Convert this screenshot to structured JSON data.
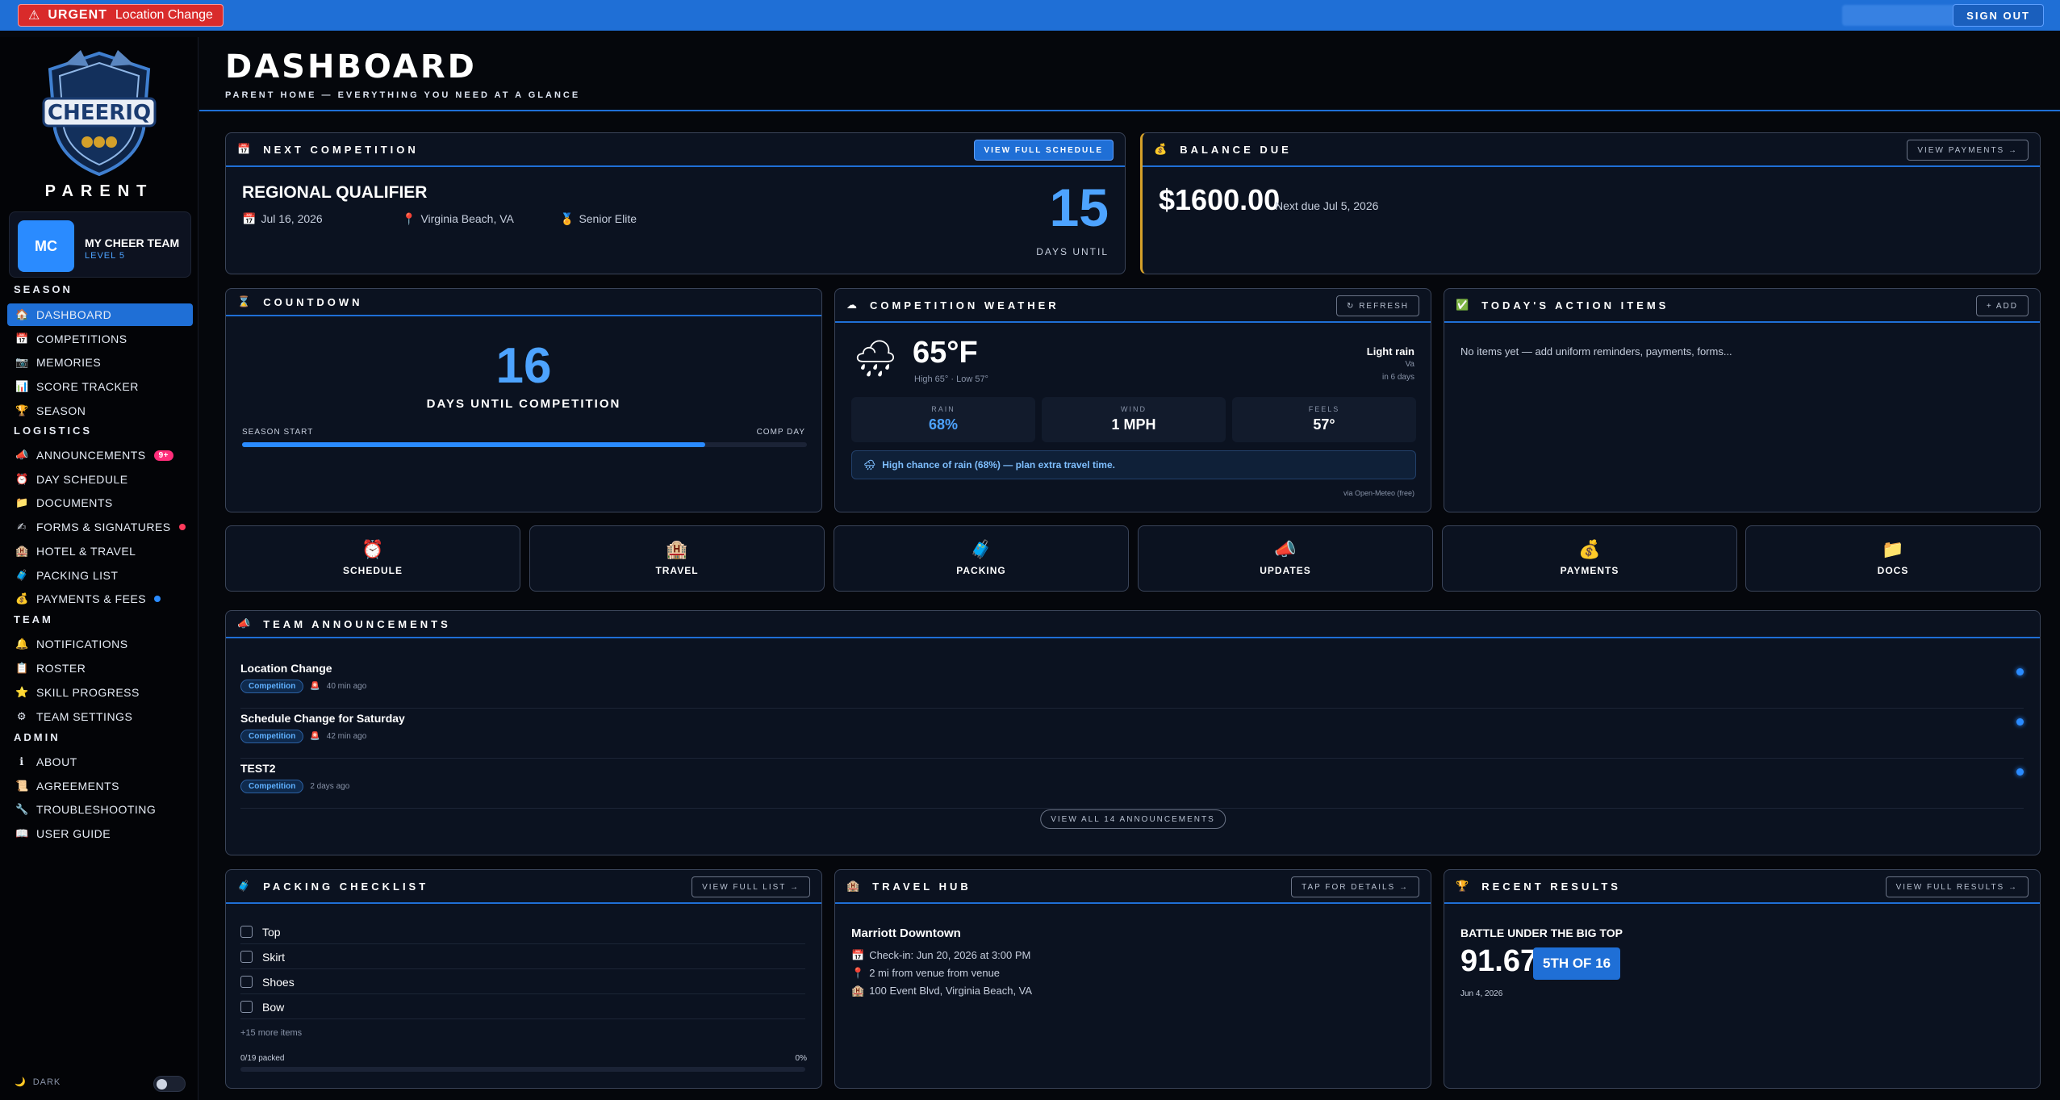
{
  "topbar": {
    "urgent_tag": "URGENT",
    "urgent_text": "Location Change",
    "signout": "SIGN OUT"
  },
  "sidebar": {
    "logo_text": "CHEERIQ",
    "role": "PARENT",
    "team": {
      "initials": "MC",
      "name": "MY CHEER TEAM",
      "level": "LEVEL 5"
    },
    "sections": {
      "season": "SEASON",
      "logistics": "LOGISTICS",
      "team": "TEAM",
      "admin": "ADMIN"
    },
    "season_items": [
      {
        "label": "DASHBOARD",
        "icon": "house-icon"
      },
      {
        "label": "COMPETITIONS",
        "icon": "calendar-icon"
      },
      {
        "label": "MEMORIES",
        "icon": "camera-icon"
      },
      {
        "label": "SCORE TRACKER",
        "icon": "chart-icon"
      },
      {
        "label": "SEASON",
        "icon": "trophy-icon"
      }
    ],
    "logistics_items": [
      {
        "label": "ANNOUNCEMENTS",
        "icon": "megaphone-icon",
        "badge": "9+"
      },
      {
        "label": "DAY SCHEDULE",
        "icon": "alarm-clock-icon"
      },
      {
        "label": "DOCUMENTS",
        "icon": "folder-icon"
      },
      {
        "label": "FORMS & SIGNATURES",
        "icon": "writing-hand-icon"
      },
      {
        "label": "HOTEL & TRAVEL",
        "icon": "hotel-icon"
      },
      {
        "label": "PACKING LIST",
        "icon": "luggage-icon"
      },
      {
        "label": "PAYMENTS & FEES",
        "icon": "money-bag-icon"
      }
    ],
    "team_items": [
      {
        "label": "NOTIFICATIONS",
        "icon": "bell-icon"
      },
      {
        "label": "ROSTER",
        "icon": "clipboard-icon"
      },
      {
        "label": "SKILL PROGRESS",
        "icon": "star-icon"
      },
      {
        "label": "TEAM SETTINGS",
        "icon": "gear-icon"
      }
    ],
    "admin_items": [
      {
        "label": "ABOUT",
        "icon": "info-icon"
      },
      {
        "label": "AGREEMENTS",
        "icon": "scroll-icon"
      },
      {
        "label": "TROUBLESHOOTING",
        "icon": "wrench-icon"
      },
      {
        "label": "USER GUIDE",
        "icon": "book-icon"
      }
    ],
    "dark_label": "DARK"
  },
  "header": {
    "title": "DASHBOARD",
    "subtitle": "PARENT HOME — EVERYTHING YOU NEED AT A GLANCE"
  },
  "next_comp": {
    "heading": "NEXT COMPETITION",
    "button": "VIEW FULL SCHEDULE",
    "name": "REGIONAL QUALIFIER",
    "date": "Jul 16, 2026",
    "location": "Virginia Beach, VA",
    "division": "Senior Elite",
    "days": "15",
    "days_label": "DAYS UNTIL"
  },
  "balance": {
    "heading": "BALANCE DUE",
    "button": "VIEW PAYMENTS →",
    "amount": "$1600.00",
    "due": "Next due Jul 5, 2026"
  },
  "countdown": {
    "heading": "COUNTDOWN",
    "days": "16",
    "label": "DAYS UNTIL COMPETITION",
    "start": "SEASON START",
    "end": "COMP DAY",
    "progress": 0.82
  },
  "weather": {
    "heading": "COMPETITION WEATHER",
    "button": "↻ REFRESH",
    "temp": "65°F",
    "hilo": "High 65° · Low 57°",
    "condition": "Light rain",
    "region": "Va",
    "when": "in 6 days",
    "rain_label": "RAIN",
    "rain": "68%",
    "wind_label": "WIND",
    "wind": "1 MPH",
    "feels_label": "FEELS",
    "feels": "57°",
    "alert": "High chance of rain (68%) — plan extra travel time.",
    "source": "via Open-Meteo (free)"
  },
  "actions": {
    "heading": "TODAY'S ACTION ITEMS",
    "button": "+ ADD",
    "empty": "No items yet — add uniform reminders, payments, forms..."
  },
  "tiles": [
    {
      "label": "SCHEDULE",
      "icon": "alarm-clock-icon",
      "glyph": "⏰"
    },
    {
      "label": "TRAVEL",
      "icon": "hotel-icon",
      "glyph": "🏨"
    },
    {
      "label": "PACKING",
      "icon": "luggage-icon",
      "glyph": "🧳"
    },
    {
      "label": "UPDATES",
      "icon": "megaphone-icon",
      "glyph": "📣"
    },
    {
      "label": "PAYMENTS",
      "icon": "money-bag-icon",
      "glyph": "💰"
    },
    {
      "label": "DOCS",
      "icon": "folder-icon",
      "glyph": "📁"
    }
  ],
  "announcements": {
    "heading": "TEAM ANNOUNCEMENTS",
    "view_all": "VIEW ALL 14 ANNOUNCEMENTS",
    "items": [
      {
        "title": "Location Change",
        "tag": "Competition",
        "time": "40 min ago"
      },
      {
        "title": "Schedule Change for Saturday",
        "tag": "Competition",
        "time": "42 min ago"
      },
      {
        "title": "TEST2",
        "tag": "Competition",
        "time": "2 days ago"
      }
    ]
  },
  "packing": {
    "heading": "PACKING CHECKLIST",
    "button": "VIEW FULL LIST →",
    "items": [
      "Top",
      "Skirt",
      "Shoes",
      "Bow"
    ],
    "more": "+15 more items",
    "packed": "0/19 packed",
    "percent": "0%",
    "progress": 0
  },
  "travel": {
    "heading": "TRAVEL HUB",
    "button": "TAP FOR DETAILS →",
    "hotel": "Marriott Downtown",
    "checkin": "Check-in: Jun 20, 2026 at 3:00 PM",
    "distance": "2 mi from venue from venue",
    "address": "100 Event Blvd, Virginia Beach, VA"
  },
  "results": {
    "heading": "RECENT RESULTS",
    "button": "VIEW FULL RESULTS →",
    "event": "BATTLE UNDER THE BIG TOP",
    "score": "91.67",
    "place": "5TH OF 16",
    "date": "Jun 4, 2026"
  },
  "colors": {
    "accent": "#1f6fd6",
    "urgent": "#d92b2b",
    "score_blue": "#4da3ff"
  }
}
